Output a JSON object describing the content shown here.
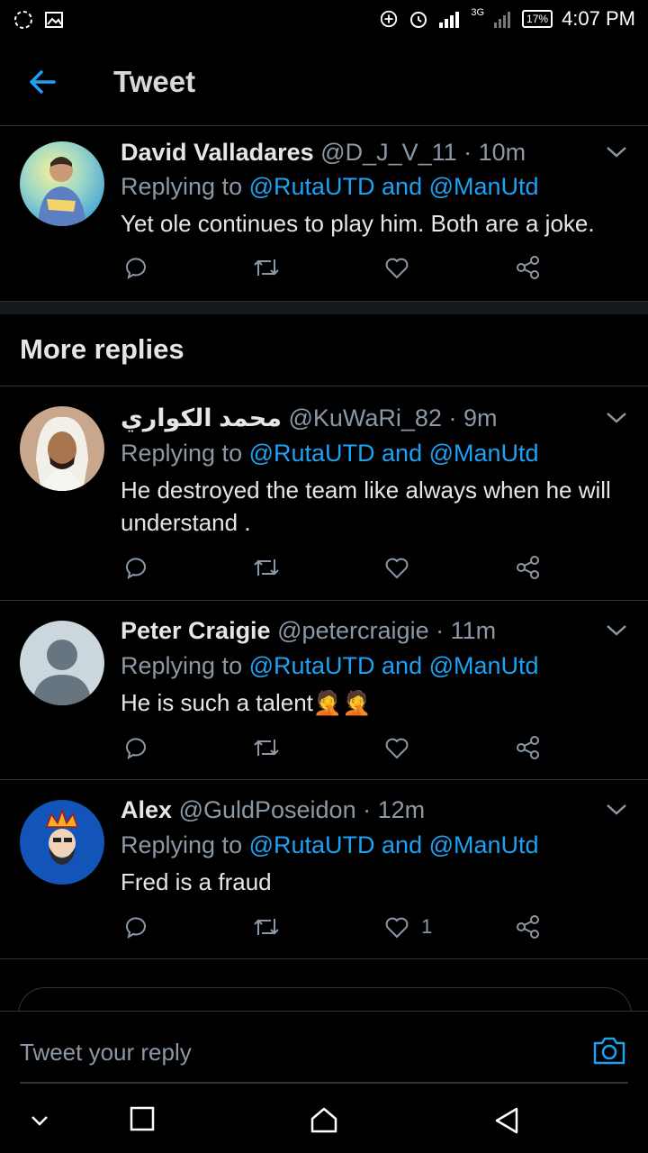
{
  "status": {
    "time": "4:07 PM",
    "battery": "17%",
    "network": "3G"
  },
  "header": {
    "title": "Tweet"
  },
  "main_tweet": {
    "name": "David Valladares",
    "handle": "@D_J_V_11 · 10m",
    "replying_prefix": "Replying to",
    "replying_to": "@RutaUTD and @ManUtd",
    "text": "Yet ole continues to play him. Both are a joke."
  },
  "section": {
    "more_replies": "More replies"
  },
  "replies": [
    {
      "name": "محمد الكواري",
      "handle": "@KuWaRi_82 · 9m",
      "replying_prefix": "Replying to",
      "replying_to": "@RutaUTD and @ManUtd",
      "text": "He destroyed the team like always when he will understand ."
    },
    {
      "name": "Peter Craigie",
      "handle": "@petercraigie · 11m",
      "replying_prefix": "Replying to",
      "replying_to": "@RutaUTD and @ManUtd",
      "text": "He is such a talent🤦🤦"
    },
    {
      "name": "Alex",
      "handle": "@GuldPoseidon · 12m",
      "replying_prefix": "Replying to",
      "replying_to": "@RutaUTD and @ManUtd",
      "text": "Fred is a fraud",
      "like_count": "1"
    }
  ],
  "compose": {
    "placeholder": "Tweet your reply"
  },
  "colors": {
    "accent": "#1da1f2",
    "muted": "#8b98a5",
    "background": "#000000"
  },
  "icons": [
    "reply-icon",
    "retweet-icon",
    "like-icon",
    "share-icon",
    "chevron-down-icon",
    "camera-icon",
    "back-arrow-icon"
  ]
}
